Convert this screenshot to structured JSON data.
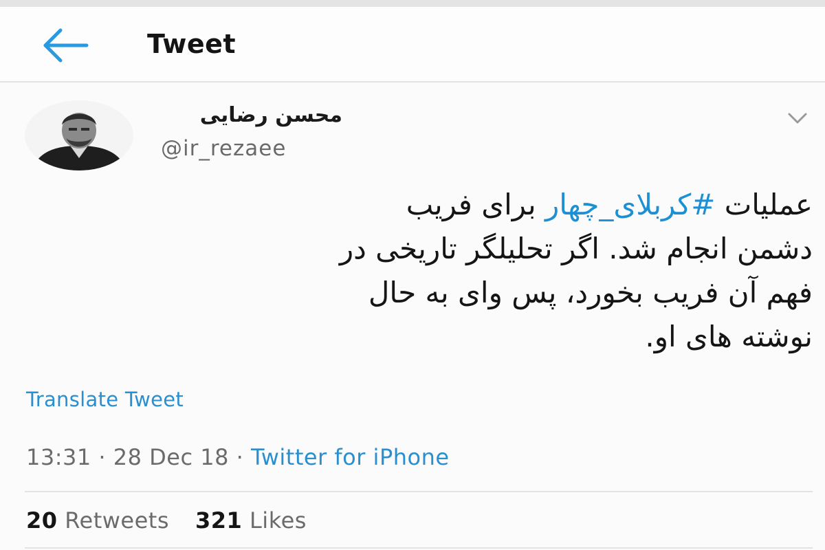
{
  "header": {
    "title": "Tweet",
    "back_icon": "arrow-left-icon",
    "accent_color": "#1da1f2"
  },
  "tweet": {
    "author": {
      "display_name": "محسن رضایی",
      "handle": "@ir_rezaee"
    },
    "text": {
      "line1_before": "عملیات ",
      "hashtag": "#کربلای_چهار",
      "line1_after": " برای فریب",
      "line2": "دشمن انجام شد. اگر تحلیلگر تاریخی  در",
      "line3": "فهم آن فریب بخورد، پس وای به حال",
      "line4": "نوشته های او."
    },
    "translate_label": "Translate Tweet",
    "meta": {
      "time": "13:31",
      "separator": "·",
      "date": "28 Dec 18",
      "source": "Twitter for iPhone"
    },
    "stats": {
      "retweets_count": "20",
      "retweets_label": "Retweets",
      "likes_count": "321",
      "likes_label": "Likes"
    }
  }
}
